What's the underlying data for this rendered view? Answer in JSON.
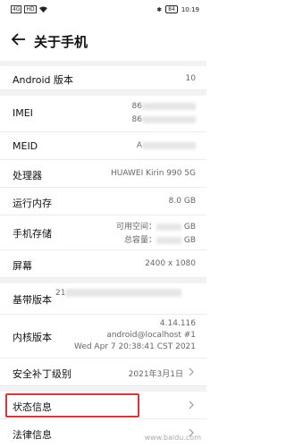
{
  "status_bar": {
    "badges": [
      "4G",
      "HD"
    ],
    "battery": "84",
    "time": "10:19"
  },
  "header": {
    "title": "关于手机"
  },
  "rows": {
    "android_version": {
      "label": "Android 版本",
      "value": "10"
    },
    "imei": {
      "label": "IMEI",
      "line1": "86",
      "line2": "86"
    },
    "meid": {
      "label": "MEID",
      "value": "A"
    },
    "processor": {
      "label": "处理器",
      "value": "HUAWEI Kirin 990 5G"
    },
    "ram": {
      "label": "运行内存",
      "value": "8.0 GB"
    },
    "storage": {
      "label": "手机存储",
      "available": "可用空间：",
      "total": "总容量：",
      "unit": "GB"
    },
    "screen": {
      "label": "屏幕",
      "value": "2400 x 1080"
    },
    "baseband": {
      "label": "基带版本",
      "value": "21"
    },
    "kernel": {
      "label": "内核版本",
      "line1": "4.14.116",
      "line2": "android@localhost #1",
      "line3": "Wed Apr 7 20:38:41 CST 2021"
    },
    "security_patch": {
      "label": "安全补丁级别",
      "value": "2021年3月1日"
    },
    "status_info": {
      "label": "状态信息"
    },
    "legal": {
      "label": "法律信息"
    }
  },
  "watermark": "www.baidu.com"
}
